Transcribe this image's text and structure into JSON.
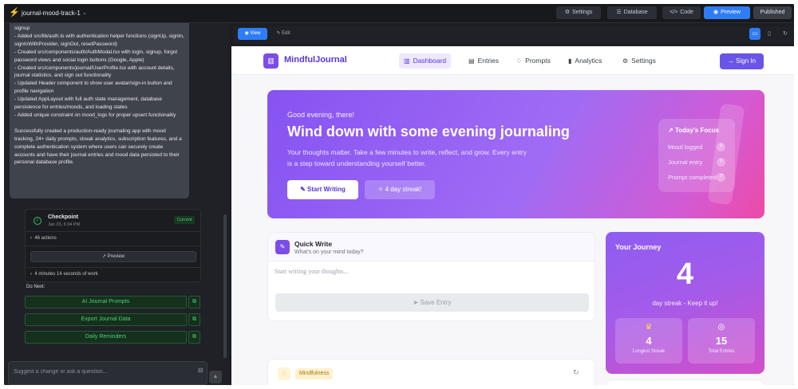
{
  "topbar": {
    "project_name": "journal-mood-track-1",
    "settings_label": "Settings",
    "database_label": "Database",
    "code_label": "Code",
    "preview_label": "Preview",
    "published_label": "Published"
  },
  "chat": {
    "message": "signup\n- Added src/lib/auth.ts with authentication helper functions (signUp, signIn, signInWithProvider, signOut, resetPassword)\n- Created src/components/auth/AuthModal.tsx with login, signup, forgot password views and social login buttons (Google, Apple)\n- Created src/components/journal/UserProfile.tsx with account details, journal statistics, and sign out functionality\n- Updated Header component to show user avatar/sign-in button and profile navigation\n- Updated AppLayout with full auth state management, database persistence for entries/moods, and loading states\n- Added unique constraint on mood_logs for proper upsert functionality\n\nSuccessfully created a production-ready journaling app with mood tracking, 24+ daily prompts, streak analytics, subscription features, and a complete authentication system where users can securely create accounts and have their journal entries and mood data persisted to their personal database profile.",
    "checkpoint": {
      "title": "Checkpoint",
      "date": "Jan 23, 6:34 PM",
      "status": "Current",
      "actions": "46 actions",
      "preview_label": "Preview",
      "work_time": "4 minutes 14 seconds of work"
    },
    "do_next_label": "Do Next:",
    "suggestions": [
      "AI Journal Prompts",
      "Export Journal Data",
      "Daily Reminders"
    ],
    "input_placeholder": "Suggest a change or ask a question..."
  },
  "preview_toolbar": {
    "view_label": "View",
    "edit_label": "Edit"
  },
  "app": {
    "brand": "MindfulJournal",
    "nav": {
      "dashboard": "Dashboard",
      "entries": "Entries",
      "prompts": "Prompts",
      "analytics": "Analytics",
      "settings": "Settings"
    },
    "sign_in": "Sign In",
    "hero": {
      "greeting": "Good evening, there!",
      "title": "Wind down with some evening journaling",
      "subtitle": "Your thoughts matter. Take a few minutes to write, reflect, and grow. Every entry is a step toward understanding yourself better.",
      "start_writing": "Start Writing",
      "streak_badge": "4 day streak!",
      "focus": {
        "title": "Today's Focus",
        "items": [
          "Mood logged",
          "Journal entry",
          "Prompt completed"
        ],
        "marker": "?"
      }
    },
    "quick_write": {
      "title": "Quick Write",
      "subtitle": "What's on your mind today?",
      "placeholder": "Start writing your thoughts...",
      "save_label": "Save Entry"
    },
    "journey": {
      "title": "Your Journey",
      "streak": "4",
      "streak_label": "day streak - Keep it up!",
      "longest_value": "4",
      "longest_label": "Longest Streak",
      "total_value": "15",
      "total_label": "Total Entries"
    },
    "prompt_card": {
      "tag": "Mindfulness"
    }
  },
  "colors": {
    "accent": "#6a55e8",
    "brand": "#5a35d6",
    "success": "#4fcf76",
    "preview_blue": "#2f7df6"
  }
}
